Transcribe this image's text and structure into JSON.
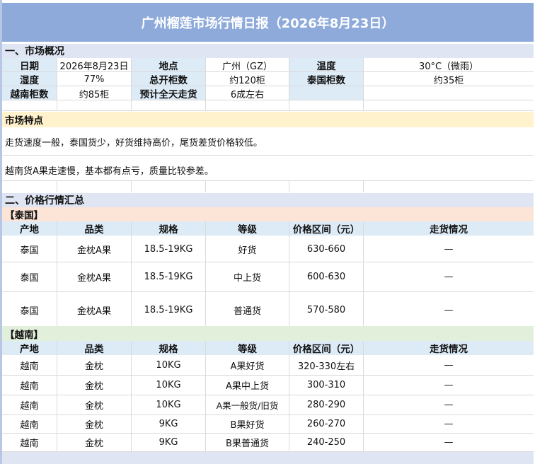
{
  "title": "广州榴莲市场行情日报（2026年8月23日）",
  "overview": {
    "section_title": "一、市场概况",
    "date_label": "日期",
    "date_value": "2026年8月23日",
    "location_label": "地点",
    "location_value": "广州（GZ）",
    "temp_label": "温度",
    "temp_value": "30°C（微雨）",
    "humidity_label": "湿度",
    "humidity_value": "77%",
    "total_label": "总开柜数",
    "total_value": "约120柜",
    "thai_label": "泰国柜数",
    "thai_value": "约35柜",
    "vn_label": "越南柜数",
    "vn_value": "约85柜",
    "sell_label": "预计全天走货",
    "sell_value": "6成左右"
  },
  "features": {
    "title": "市场特点",
    "line1": "走货速度一般，泰国货少，好货维持高价，尾货差货价格较低。",
    "line2": "越南货A果走速慢，基本都有点亏，质量比较参差。"
  },
  "prices": {
    "section_title": "二、价格行情汇总",
    "headers": [
      "产地",
      "品类",
      "规格",
      "等级",
      "价格区间（元）",
      "走货情况"
    ],
    "thailand": {
      "title": "【泰国】",
      "rows": [
        [
          "泰国",
          "金枕A果",
          "18.5-19KG",
          "好货",
          "630-660",
          "—"
        ],
        [
          "泰国",
          "金枕A果",
          "18.5-19KG",
          "中上货",
          "600-630",
          "—"
        ],
        [
          "泰国",
          "金枕A果",
          "18.5-19KG",
          "普通货",
          "570-580",
          "—"
        ]
      ]
    },
    "vietnam": {
      "title": "【越南】",
      "rows": [
        [
          "越南",
          "金枕",
          "10KG",
          "A果好货",
          "320-330左右",
          "—"
        ],
        [
          "越南",
          "金枕",
          "10KG",
          "A果中上货",
          "300-310",
          "—"
        ],
        [
          "越南",
          "金枕",
          "10KG",
          "A果一般货/旧货",
          "280-290",
          "—"
        ],
        [
          "越南",
          "金枕",
          "9KG",
          "B果好货",
          "260-270",
          "—"
        ],
        [
          "越南",
          "金枕",
          "9KG",
          "B果普通货",
          "240-250",
          "—"
        ]
      ]
    }
  },
  "colors": {
    "title_bg": "#8eaadb",
    "section_bg": "#dfe5f3",
    "label_bg": "#ddebf7",
    "features_bg": "#fff2cc",
    "thai_band": "#fce4d6",
    "vn_band": "#e2efda"
  }
}
